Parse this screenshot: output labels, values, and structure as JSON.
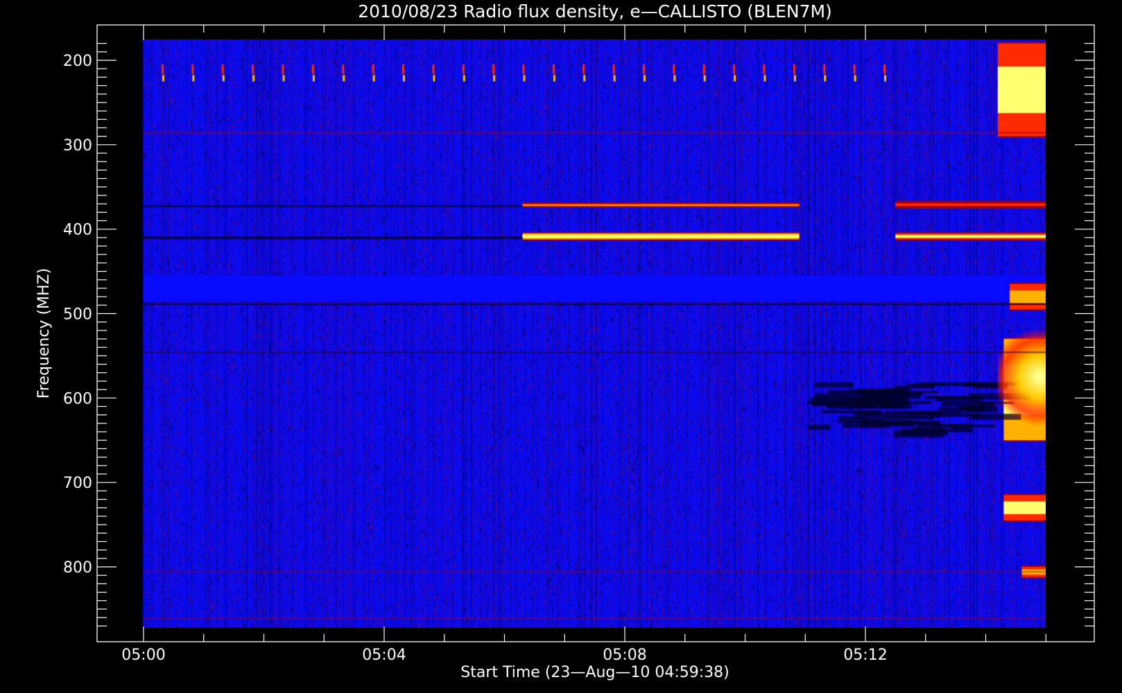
{
  "chart_data": {
    "type": "heatmap",
    "title": "2010/08/23  Radio flux density, e—CALLISTO (BLEN7M)",
    "xlabel": "Start Time (23—Aug—10 04:59:38)",
    "ylabel": "Frequency (MHZ)",
    "x_ticks": [
      "05:00",
      "05:04",
      "05:08",
      "05:12"
    ],
    "x_range_minutes": [
      0,
      15
    ],
    "y_ticks": [
      200,
      300,
      400,
      500,
      600,
      700,
      800
    ],
    "y_range_mhz": [
      175,
      870
    ],
    "y_axis_inverted": true,
    "colormap": [
      "#000000",
      "#0000ff",
      "#b00020",
      "#ff3a00",
      "#ffd000",
      "#ffff80"
    ],
    "background_color": "#0a0aee",
    "features": [
      {
        "name": "periodic-interference",
        "freq_mhz": [
          205,
          230
        ],
        "t_min": [
          0.3,
          12.5
        ],
        "period_min": 0.5,
        "level": 0.7
      },
      {
        "name": "band-372",
        "freq_mhz": [
          370,
          373
        ],
        "t_min": [
          6.3,
          10.9
        ],
        "level": 0.8
      },
      {
        "name": "band-408",
        "freq_mhz": [
          405,
          412
        ],
        "t_min": [
          6.3,
          10.9
        ],
        "level": 1.0
      },
      {
        "name": "band-408-late",
        "freq_mhz": [
          405,
          412
        ],
        "t_min": [
          12.5,
          15.0
        ],
        "level": 0.9
      },
      {
        "name": "band-372-late",
        "freq_mhz": [
          368,
          374
        ],
        "t_min": [
          12.5,
          15.0
        ],
        "level": 0.6
      },
      {
        "name": "low-signal-band",
        "freq_mhz": [
          455,
          485
        ],
        "t_min": [
          0,
          15
        ],
        "level": 0.05
      },
      {
        "name": "burst-200",
        "freq_mhz": [
          180,
          290
        ],
        "t_min": [
          14.2,
          15.0
        ],
        "level": 0.9
      },
      {
        "name": "burst-480",
        "freq_mhz": [
          465,
          495
        ],
        "t_min": [
          14.4,
          15.0
        ],
        "level": 0.85
      },
      {
        "name": "burst-570",
        "freq_mhz": [
          530,
          650
        ],
        "t_min": [
          14.3,
          15.0
        ],
        "level": 1.0
      },
      {
        "name": "burst-730",
        "freq_mhz": [
          715,
          745
        ],
        "t_min": [
          14.3,
          15.0
        ],
        "level": 0.9
      },
      {
        "name": "burst-805",
        "freq_mhz": [
          800,
          812
        ],
        "t_min": [
          14.6,
          15.0
        ],
        "level": 0.8
      },
      {
        "name": "dark-patches-590",
        "freq_mhz": [
          580,
          640
        ],
        "t_min": [
          11.0,
          13.8
        ],
        "level": 0.02
      }
    ]
  }
}
